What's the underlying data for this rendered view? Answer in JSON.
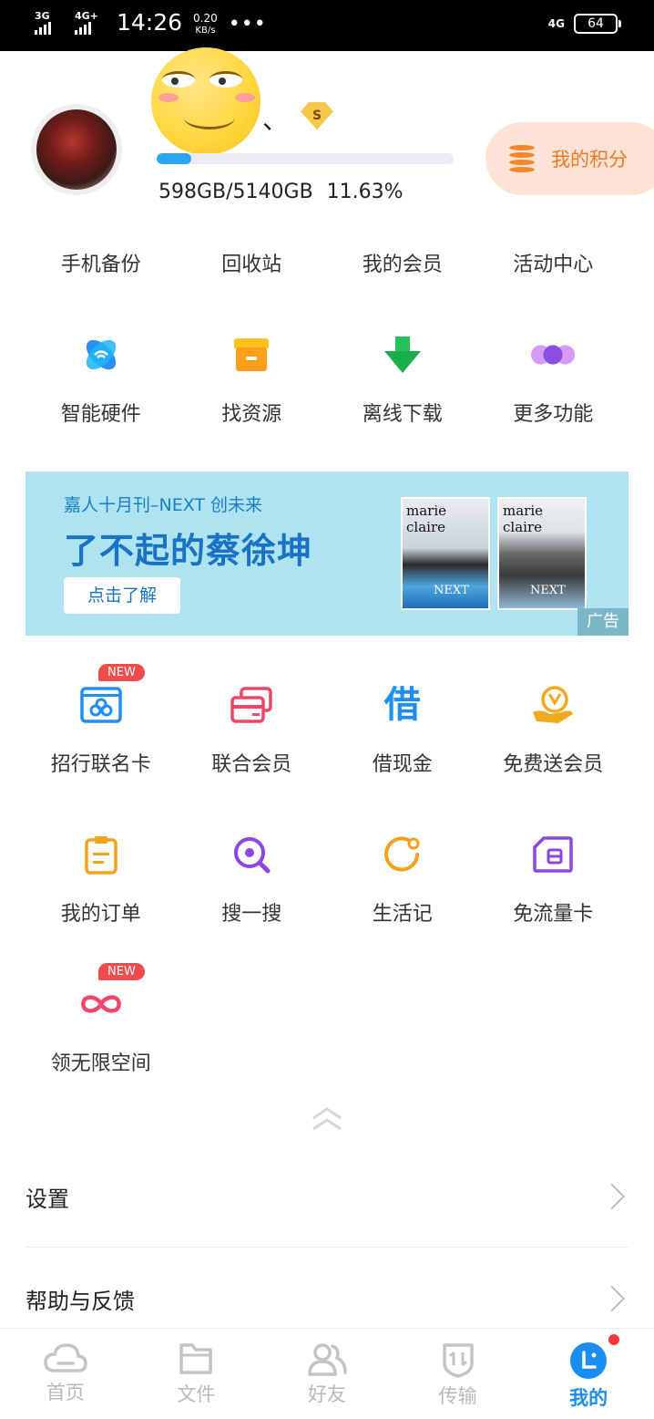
{
  "status_bar": {
    "network1": "3G",
    "network2": "4G+",
    "time": "14:26",
    "speed_value": "0.20",
    "speed_unit": "KB/s",
    "more": "•••",
    "network3": "4G",
    "battery": "64"
  },
  "profile": {
    "username": "、",
    "vip_badge": "S",
    "storage_used_fraction": 0.1163,
    "storage_text": "598GB/5140GB 11.63%",
    "points_label": "我的积分"
  },
  "quick_links": [
    "手机备份",
    "回收站",
    "我的会员",
    "活动中心"
  ],
  "tools": [
    {
      "label": "智能硬件",
      "icon": "smart-hardware-icon"
    },
    {
      "label": "找资源",
      "icon": "store-icon"
    },
    {
      "label": "离线下载",
      "icon": "download-arrow-icon"
    },
    {
      "label": "更多功能",
      "icon": "more-dots-icon"
    }
  ],
  "banner": {
    "subtitle": "嘉人十月刊–NEXT 创未来",
    "title": "了不起的蔡徐坤",
    "button": "点击了解",
    "cover1_masthead": "marie claire",
    "cover2_masthead": "marie claire",
    "cover_tag": "NEXT",
    "ad_tag": "广告"
  },
  "services": [
    {
      "label": "招行联名卡",
      "icon": "bank-card-icon",
      "badge": "NEW"
    },
    {
      "label": "联合会员",
      "icon": "joint-member-card-icon"
    },
    {
      "label": "借现金",
      "icon": "borrow-cash-icon",
      "glyph": "借"
    },
    {
      "label": "免费送会员",
      "icon": "free-vip-hand-icon"
    },
    {
      "label": "我的订单",
      "icon": "order-clipboard-icon"
    },
    {
      "label": "搜一搜",
      "icon": "search-icon"
    },
    {
      "label": "生活记",
      "icon": "life-log-icon"
    },
    {
      "label": "免流量卡",
      "icon": "sim-card-icon"
    },
    {
      "label": "领无限空间",
      "icon": "infinity-icon",
      "badge": "NEW"
    }
  ],
  "settings": [
    {
      "label": "设置"
    },
    {
      "label": "帮助与反馈"
    }
  ],
  "nav": [
    {
      "label": "首页",
      "icon": "cloud-icon"
    },
    {
      "label": "文件",
      "icon": "folder-icon"
    },
    {
      "label": "好友",
      "icon": "friends-icon"
    },
    {
      "label": "传输",
      "icon": "transfer-icon"
    },
    {
      "label": "我的",
      "icon": "profile-icon",
      "active": true
    }
  ],
  "colors": {
    "accent": "#1a8ef0",
    "points_bg": "#fde3d6",
    "points_text": "#f07a22",
    "banner_bg": "#aee3f1",
    "badge_red": "#f24b4b"
  }
}
